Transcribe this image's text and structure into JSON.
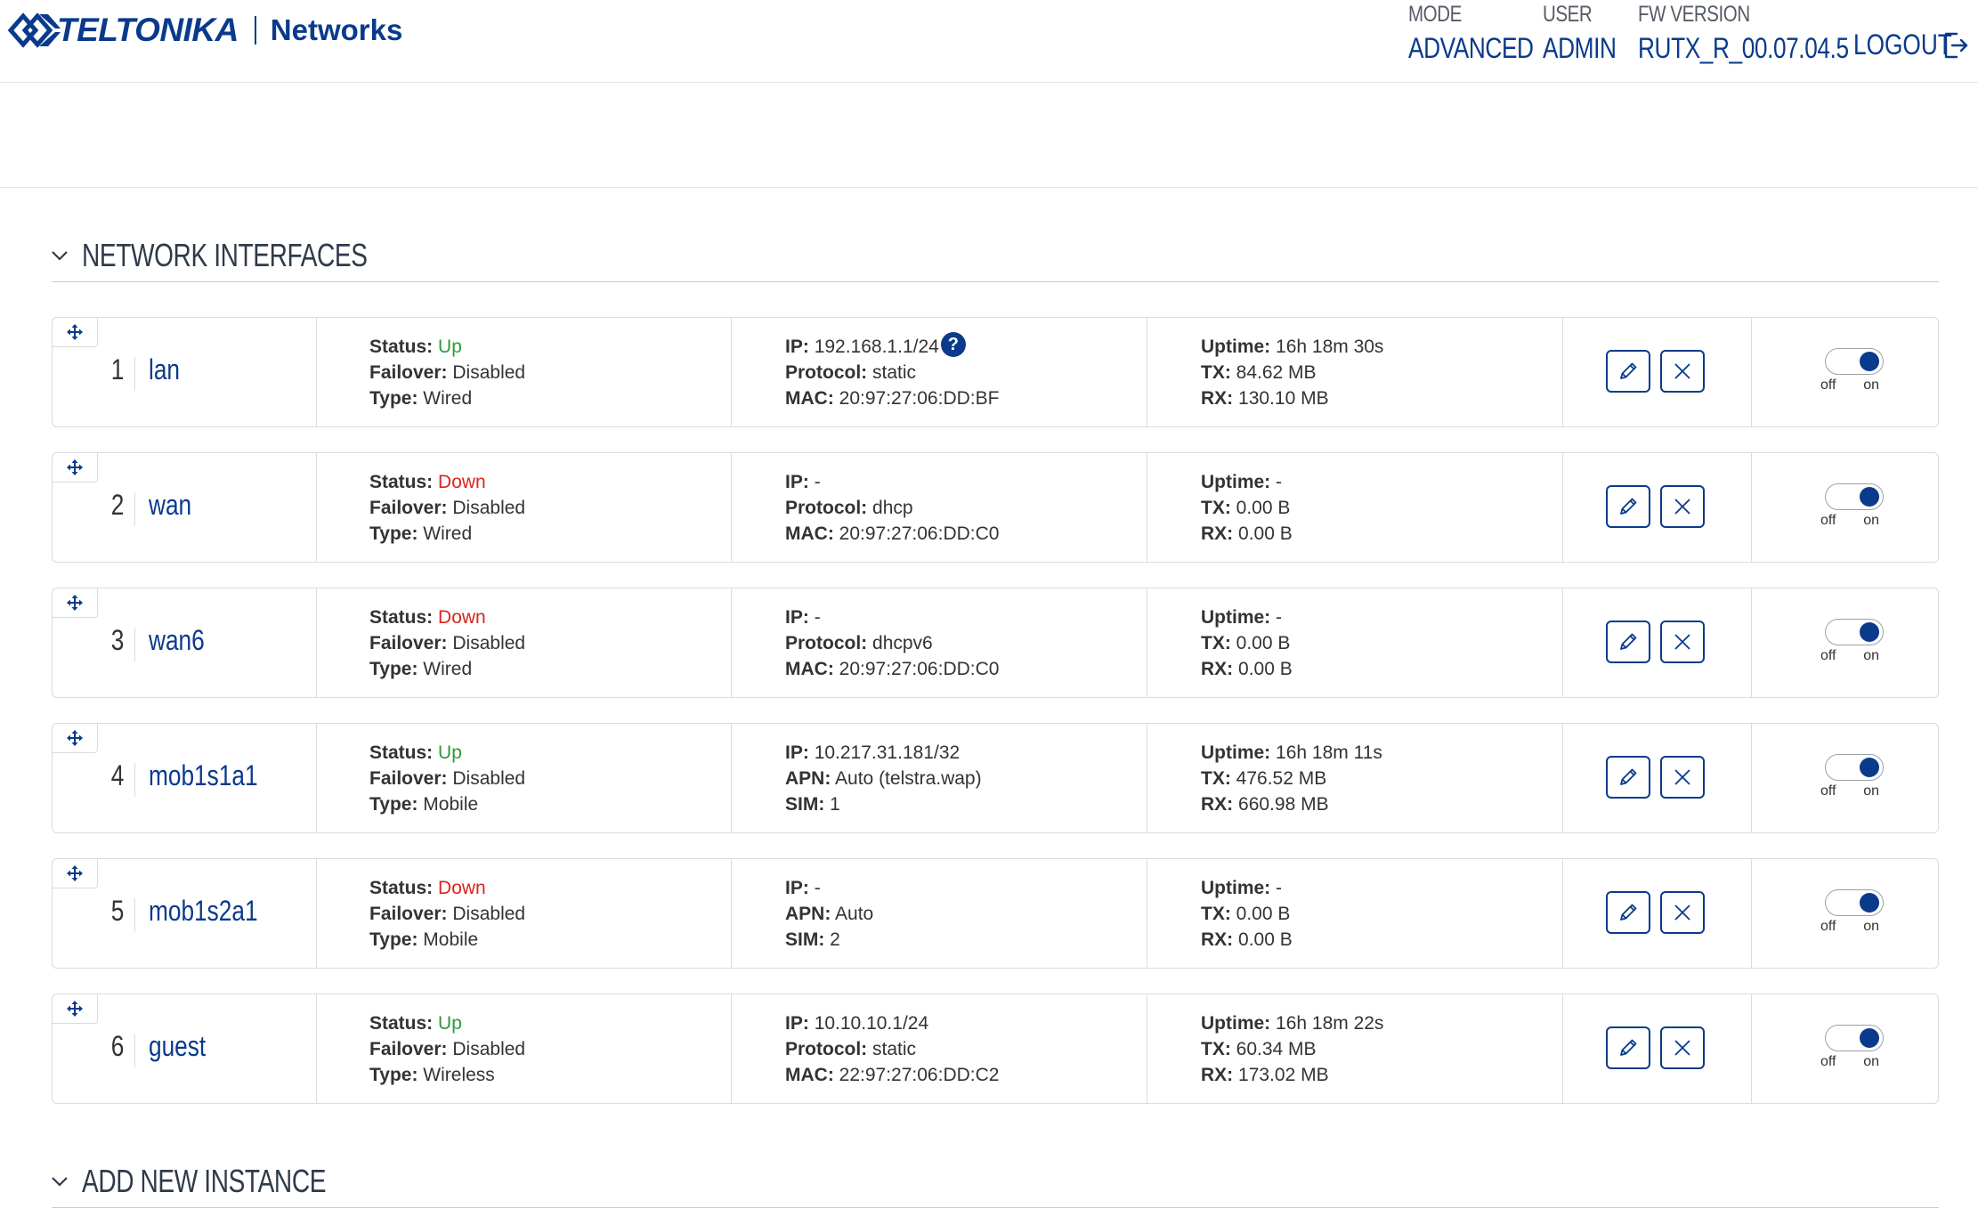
{
  "brand": {
    "name": "TELTONIKA",
    "sub": "Networks"
  },
  "header": {
    "mode": {
      "label": "MODE",
      "value": "ADVANCED"
    },
    "user": {
      "label": "USER",
      "value": "ADMIN"
    },
    "fw": {
      "label": "FW VERSION",
      "value": "RUTX_R_00.07.04.5"
    },
    "logout": "LOGOUT"
  },
  "sections": {
    "interfaces": "NETWORK INTERFACES",
    "add": "ADD NEW INSTANCE"
  },
  "labels": {
    "status": "Status:",
    "failover": "Failover:",
    "type": "Type:",
    "ip": "IP:",
    "protocol": "Protocol:",
    "mac": "MAC:",
    "apn": "APN:",
    "sim": "SIM:",
    "uptime": "Uptime:",
    "tx": "TX:",
    "rx": "RX:",
    "off": "off",
    "on": "on",
    "help": "?"
  },
  "colors": {
    "accent": "#0a3a8c",
    "up": "#2b9a3a",
    "down": "#d9251d"
  },
  "interfaces": [
    {
      "index": "1",
      "name": "lan",
      "status": "Up",
      "failover": "Disabled",
      "type": "Wired",
      "k2": "IP:",
      "v2": "192.168.1.1/24",
      "help": true,
      "k3": "Protocol:",
      "v3": "static",
      "k4": "MAC:",
      "v4": "20:97:27:06:DD:BF",
      "uptime": "16h 18m 30s",
      "tx": "84.62 MB",
      "rx": "130.10 MB",
      "enabled": true
    },
    {
      "index": "2",
      "name": "wan",
      "status": "Down",
      "failover": "Disabled",
      "type": "Wired",
      "k2": "IP:",
      "v2": "-",
      "help": false,
      "k3": "Protocol:",
      "v3": "dhcp",
      "k4": "MAC:",
      "v4": "20:97:27:06:DD:C0",
      "uptime": "-",
      "tx": "0.00 B",
      "rx": "0.00 B",
      "enabled": true
    },
    {
      "index": "3",
      "name": "wan6",
      "status": "Down",
      "failover": "Disabled",
      "type": "Wired",
      "k2": "IP:",
      "v2": "-",
      "help": false,
      "k3": "Protocol:",
      "v3": "dhcpv6",
      "k4": "MAC:",
      "v4": "20:97:27:06:DD:C0",
      "uptime": "-",
      "tx": "0.00 B",
      "rx": "0.00 B",
      "enabled": true
    },
    {
      "index": "4",
      "name": "mob1s1a1",
      "status": "Up",
      "failover": "Disabled",
      "type": "Mobile",
      "k2": "IP:",
      "v2": "10.217.31.181/32",
      "help": false,
      "k3": "APN:",
      "v3": "Auto (telstra.wap)",
      "k4": "SIM:",
      "v4": "1",
      "uptime": "16h 18m 11s",
      "tx": "476.52 MB",
      "rx": "660.98 MB",
      "enabled": true
    },
    {
      "index": "5",
      "name": "mob1s2a1",
      "status": "Down",
      "failover": "Disabled",
      "type": "Mobile",
      "k2": "IP:",
      "v2": "-",
      "help": false,
      "k3": "APN:",
      "v3": "Auto",
      "k4": "SIM:",
      "v4": "2",
      "uptime": "-",
      "tx": "0.00 B",
      "rx": "0.00 B",
      "enabled": true
    },
    {
      "index": "6",
      "name": "guest",
      "status": "Up",
      "failover": "Disabled",
      "type": "Wireless",
      "k2": "IP:",
      "v2": "10.10.10.1/24",
      "help": false,
      "k3": "Protocol:",
      "v3": "static",
      "k4": "MAC:",
      "v4": "22:97:27:06:DD:C2",
      "uptime": "16h 18m 22s",
      "tx": "60.34 MB",
      "rx": "173.02 MB",
      "enabled": true
    }
  ]
}
